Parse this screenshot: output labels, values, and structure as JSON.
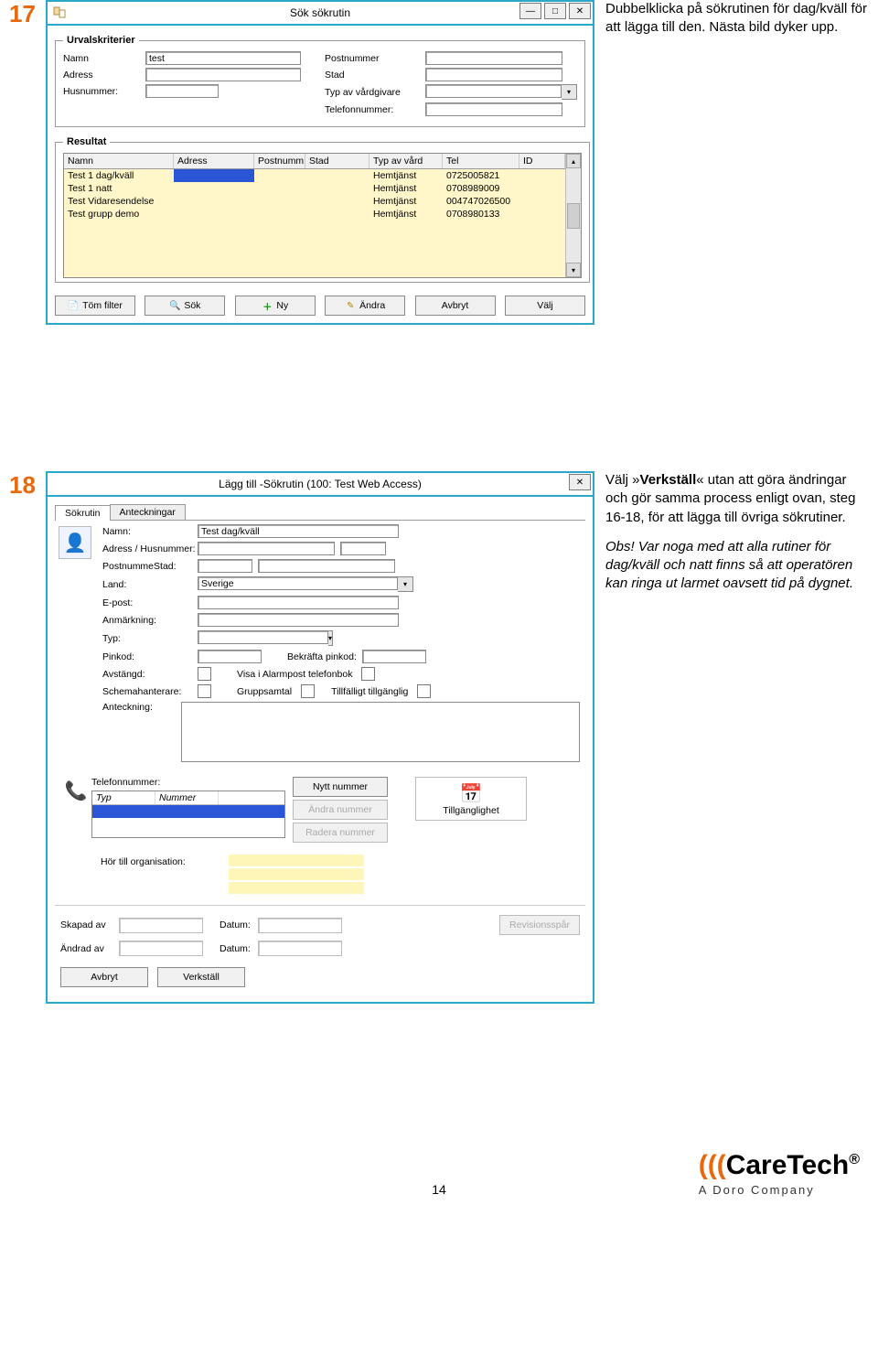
{
  "step17": {
    "number": "17",
    "desc": "Dubbelklicka på sök­rutinen för dag/kväll för att lägga till den. Nästa bild dyker upp."
  },
  "step18": {
    "number": "18",
    "desc_pre": "Välj »",
    "desc_bold": "Verkställ",
    "desc_mid": "« utan att göra ändringar och gör samma process enligt ovan, steg 16-18, för att lägga till övriga sökrutiner.",
    "desc_obs": "Obs! Var noga med att alla rutiner för dag/kväll och natt finns så att operatören kan ringa ut larmet oavsett tid på dygnet."
  },
  "win1": {
    "title": "Sök sökrutin",
    "group_urval": "Urvalskriterier",
    "labels": {
      "namn": "Namn",
      "adress": "Adress",
      "husnummer": "Husnummer:",
      "postnummer": "Postnummer",
      "stad": "Stad",
      "typvard": "Typ av vårdgivare",
      "telefon": "Telefonnummer:"
    },
    "namn_value": "test",
    "group_resultat": "Resultat",
    "columns": {
      "namn": "Namn",
      "adress": "Adress",
      "postnumm": "Postnumm",
      "stad": "Stad",
      "typ": "Typ av vård",
      "tel": "Tel",
      "id": "ID"
    },
    "rows": [
      {
        "namn": "Test 1 dag/kväll",
        "adress": "",
        "typ": "Hemtjänst",
        "tel": "0725005821"
      },
      {
        "namn": "Test 1 natt",
        "adress": "",
        "typ": "Hemtjänst",
        "tel": "0708989009"
      },
      {
        "namn": "Test Vidaresendelse",
        "adress": "",
        "typ": "Hemtjänst",
        "tel": "004747026500"
      },
      {
        "namn": "Test grupp demo",
        "adress": "",
        "typ": "Hemtjänst",
        "tel": "0708980133"
      }
    ],
    "btn_tom": "Töm filter",
    "btn_sok": "Sök",
    "btn_ny": "Ny",
    "btn_andra": "Ändra",
    "btn_avbryt": "Avbryt",
    "btn_valj": "Välj"
  },
  "win2": {
    "title": "Lägg till -Sökrutin (100: Test Web Access)",
    "tab1": "Sökrutin",
    "tab2": "Anteckningar",
    "labels": {
      "namn": "Namn:",
      "adress": "Adress / Husnummer:",
      "poststad": "PostnummeStad:",
      "land": "Land:",
      "epost": "E-post:",
      "anm": "Anmärkning:",
      "typ": "Typ:",
      "pinkod": "Pinkod:",
      "bekpin": "Bekräfta pinkod:",
      "avstangd": "Avstängd:",
      "visaalarm": "Visa i Alarmpost telefonbok",
      "schema": "Schemahanterare:",
      "grupp": "Gruppsamtal",
      "tillf": "Tillfälligt tillgänglig",
      "anteckning": "Anteckning:"
    },
    "namn_value": "Test dag/kväll",
    "land_value": "Sverige",
    "phone": {
      "teleflabel": "Telefonnummer:",
      "col_typ": "Typ",
      "col_num": "Nummer",
      "btn_ny": "Nytt nummer",
      "btn_andra": "Ändra nummer",
      "btn_radera": "Radera nummer",
      "avail_label": "Tillgänglighet"
    },
    "org_label": "Hör till organisation:",
    "meta": {
      "skapad": "Skapad av",
      "andrad": "Ändrad av",
      "datum": "Datum:",
      "rev": "Revisionsspår"
    },
    "btn_avbryt": "Avbryt",
    "btn_verkstall": "Verkställ"
  },
  "footer": {
    "page": "14",
    "brand_wave": "(((",
    "brand_text": "CareTech",
    "brand_reg": "®",
    "tag": "A Doro Company"
  }
}
